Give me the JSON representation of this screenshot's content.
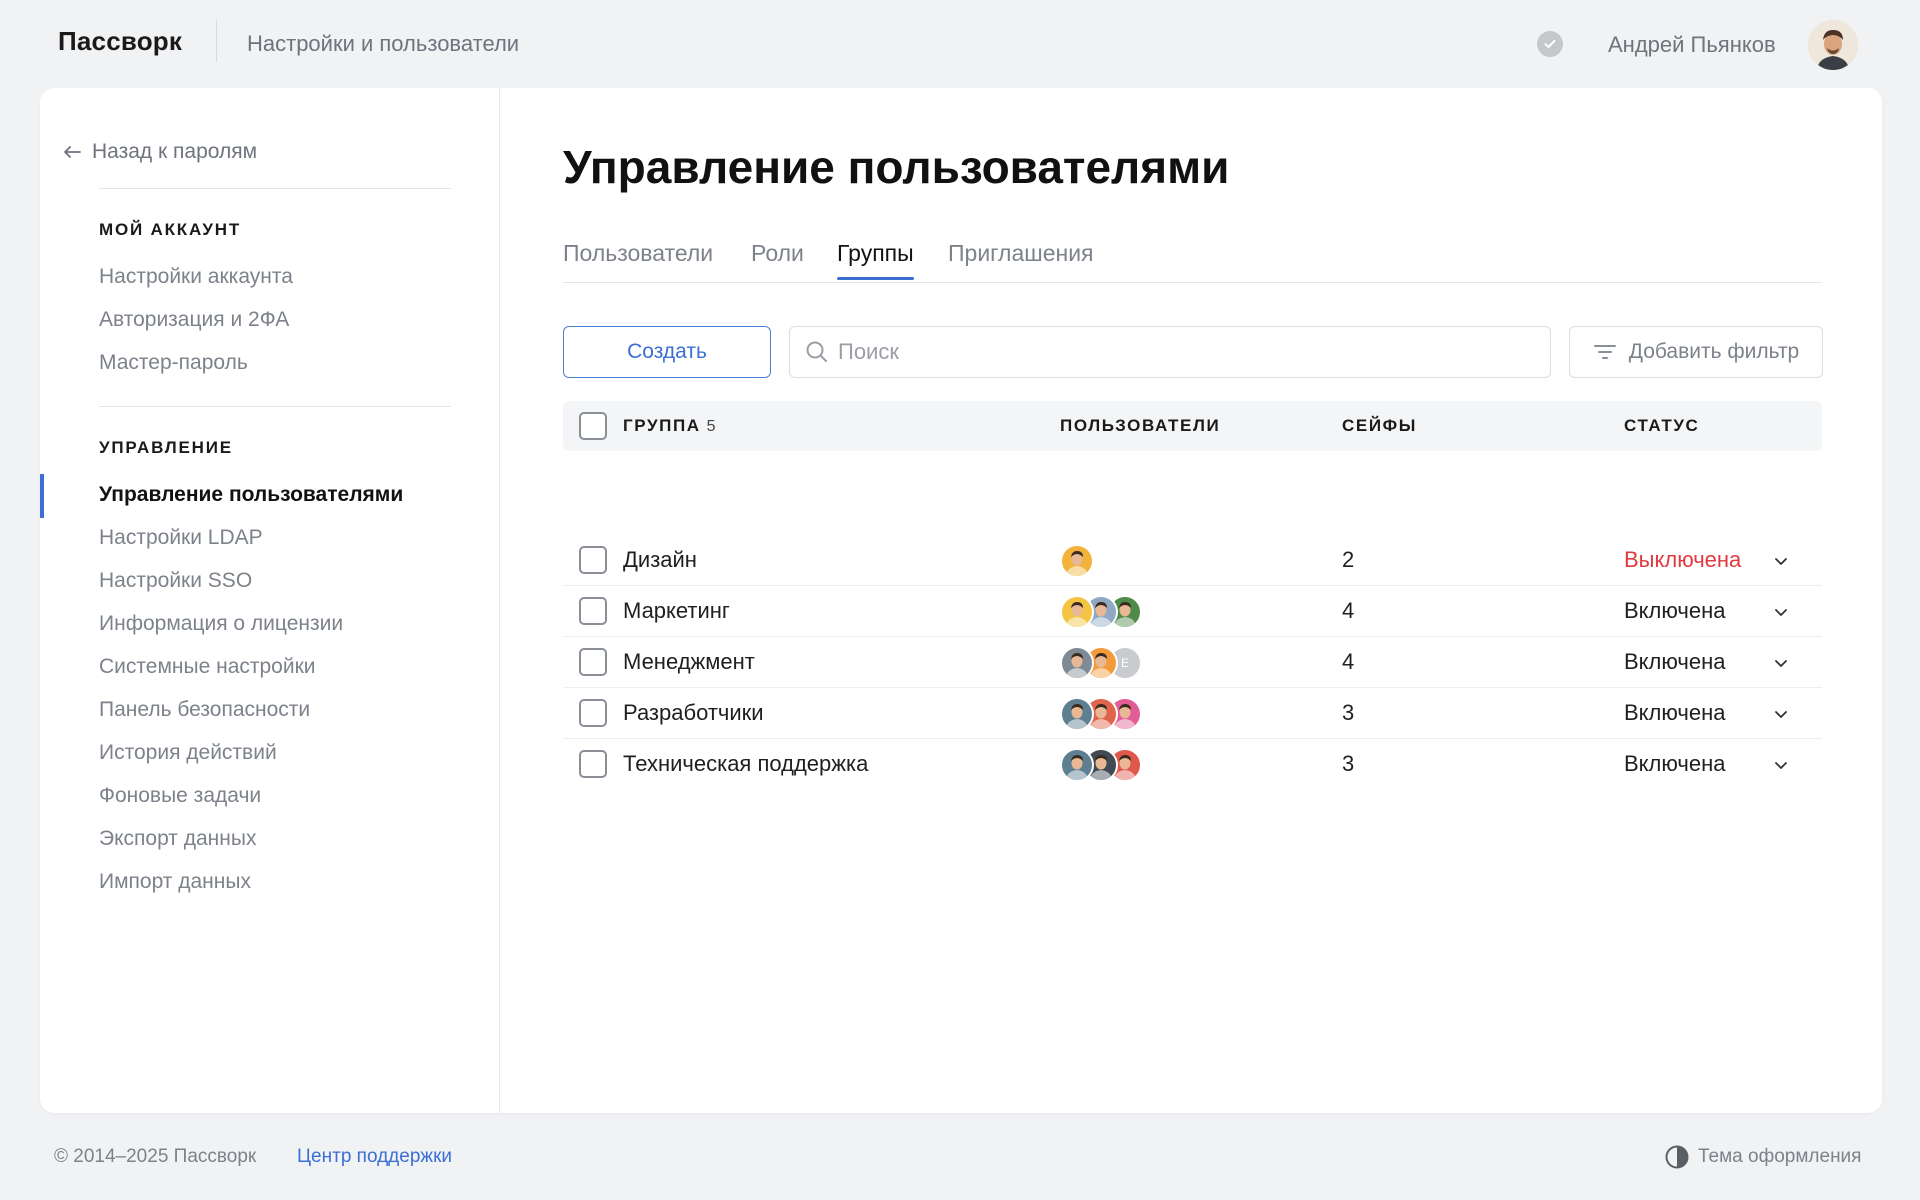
{
  "header": {
    "brand": "Пассворк",
    "breadcrumb": "Настройки и пользователи",
    "user_name": "Андрей Пьянков"
  },
  "sidebar": {
    "back_label": "Назад к паролям",
    "section_account": "МОЙ АККАУНТ",
    "account_items": [
      "Настройки аккаунта",
      "Авторизация и 2ФА",
      "Мастер-пароль"
    ],
    "section_admin": "УПРАВЛЕНИЕ",
    "admin_items": [
      "Управление пользователями",
      "Настройки LDAP",
      "Настройки SSO",
      "Информация о лицензии",
      "Системные настройки",
      "Панель безопасности",
      "История действий",
      "Фоновые задачи",
      "Экспорт данных",
      "Импорт данных"
    ],
    "active_item": "Управление пользователями"
  },
  "main": {
    "title": "Управление пользователями",
    "tabs": [
      "Пользователи",
      "Роли",
      "Группы",
      "Приглашения"
    ],
    "active_tab": "Группы",
    "create_label": "Создать",
    "search_placeholder": "Поиск",
    "filter_label": "Добавить фильтр"
  },
  "table": {
    "columns": {
      "group": "ГРУППА",
      "group_count": "5",
      "users": "ПОЛЬЗОВАТЕЛИ",
      "vaults": "СЕЙФЫ",
      "status": "СТАТУС"
    },
    "rows": [
      {
        "name": "Дизайн",
        "vaults": "2",
        "status": "Выключена",
        "status_kind": "off",
        "avatars": [
          {
            "type": "photo",
            "bg": "#f2b33d"
          }
        ]
      },
      {
        "name": "Маркетинг",
        "vaults": "4",
        "status": "Включена",
        "status_kind": "on",
        "avatars": [
          {
            "type": "photo",
            "bg": "#f4c542"
          },
          {
            "type": "photo",
            "bg": "#8fa8c4"
          },
          {
            "type": "photo",
            "bg": "#4f8a4a"
          }
        ]
      },
      {
        "name": "Менеджмент",
        "vaults": "4",
        "status": "Включена",
        "status_kind": "on",
        "avatars": [
          {
            "type": "photo",
            "bg": "#7e8b96"
          },
          {
            "type": "photo",
            "bg": "#f39a3a"
          },
          {
            "type": "letter",
            "bg": "#c9cbcf",
            "letter": "Е"
          }
        ]
      },
      {
        "name": "Разработчики",
        "vaults": "3",
        "status": "Включена",
        "status_kind": "on",
        "avatars": [
          {
            "type": "photo",
            "bg": "#5e7f91"
          },
          {
            "type": "photo",
            "bg": "#e0634b"
          },
          {
            "type": "photo",
            "bg": "#e25d95"
          }
        ]
      },
      {
        "name": "Техническая поддержка",
        "vaults": "3",
        "status": "Включена",
        "status_kind": "on",
        "avatars": [
          {
            "type": "photo",
            "bg": "#5e7f91"
          },
          {
            "type": "photo",
            "bg": "#3f4a55"
          },
          {
            "type": "photo",
            "bg": "#e0584b"
          }
        ]
      }
    ]
  },
  "footer": {
    "copyright": "© 2014–2025 Пассворк",
    "support_link": "Центр поддержки",
    "theme_label": "Тема оформления"
  },
  "colors": {
    "accent": "#3b6fd4",
    "status_off": "#e0393e",
    "background": "#f1f2f4"
  }
}
